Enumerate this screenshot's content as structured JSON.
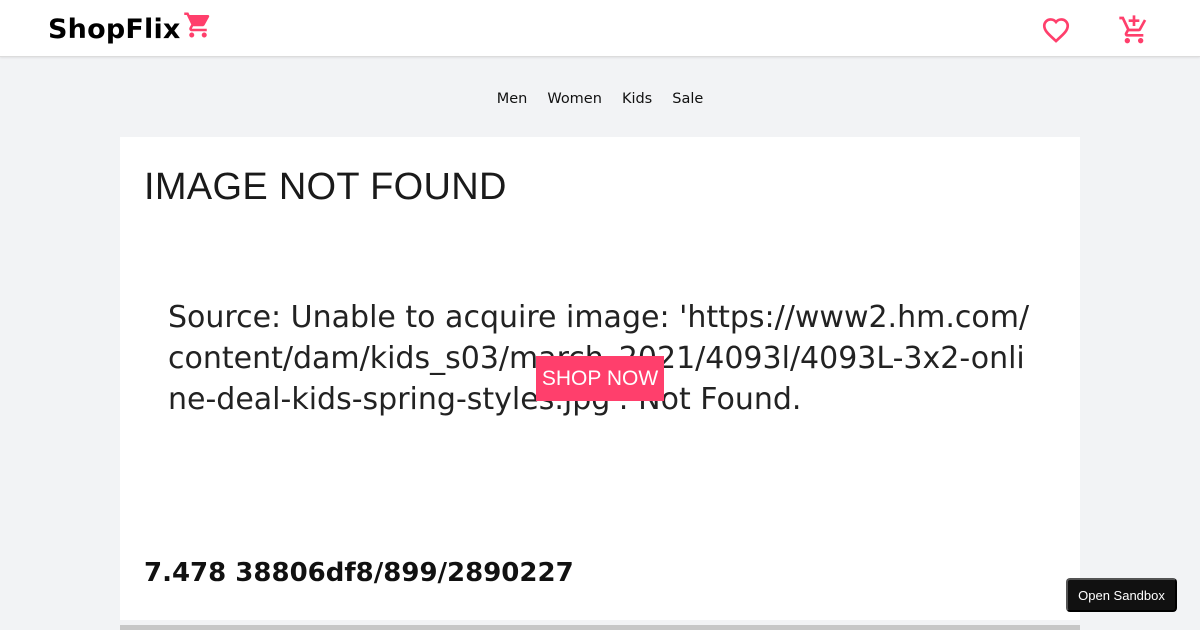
{
  "header": {
    "logo_text": "ShopFlix",
    "logo_icon": "cart-icon",
    "wishlist_icon": "heart-icon",
    "cart_icon": "cart-add-icon"
  },
  "nav": {
    "items": [
      "Men",
      "Women",
      "Kids",
      "Sale"
    ]
  },
  "banner": {
    "error_title": "IMAGE NOT FOUND",
    "error_source": "Source: Unable to acquire image: 'https://www2.hm.com/content/dam/kids_s03/march_2021/4093l/4093L-3x2-online-deal-kids-spring-styles.jpg': Not Found.",
    "error_code": "7.478 38806df8/899/2890227",
    "cta_label": "SHOP NOW"
  },
  "sandbox_label": "Open Sandbox",
  "colors": {
    "accent": "#ff3f6c",
    "page_bg": "#f2f3f5",
    "header_bg": "#ffffff",
    "sandbox_bg": "#111111"
  }
}
